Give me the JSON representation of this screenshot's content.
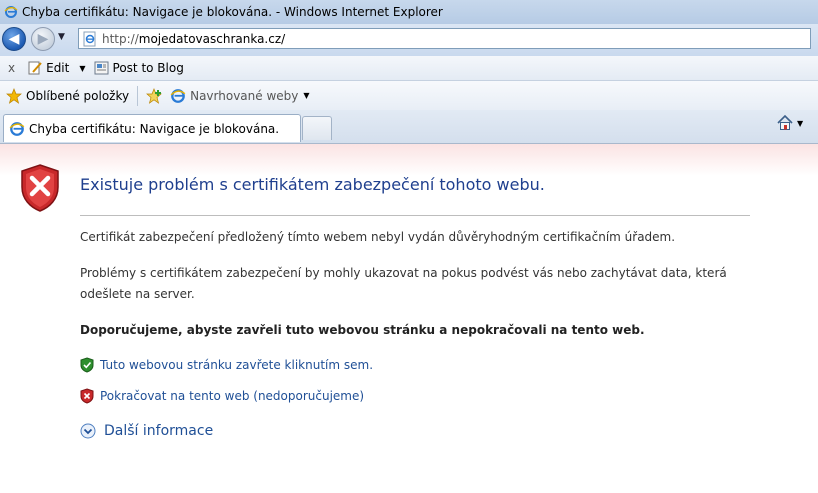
{
  "window": {
    "title": "Chyba certifikátu: Navigace je blokována. - Windows Internet Explorer"
  },
  "address": {
    "protocol": "http://",
    "host": "mojedatovaschranka.cz/"
  },
  "command_bar": {
    "close_label": "x",
    "edit_label": "Edit",
    "post_label": "Post to Blog"
  },
  "favorites_bar": {
    "favorites_label": "Oblíbené položky",
    "suggested_label": "Navrhované weby"
  },
  "tabs": [
    {
      "label": "Chyba certifikátu: Navigace je blokována."
    }
  ],
  "page": {
    "heading": "Existuje problém s certifikátem zabezpečení tohoto webu.",
    "paragraph1": "Certifikát zabezpečení předložený tímto webem nebyl vydán důvěryhodným certifikačním úřadem.",
    "paragraph2": "Problémy s certifikátem zabezpečení by mohly ukazovat na pokus podvést vás nebo zachytávat data, která odešlete na server.",
    "recommendation": "Doporučujeme, abyste zavřeli tuto webovou stránku a nepokračovali na tento web.",
    "close_link": "Tuto webovou stránku zavřete kliknutím sem.",
    "continue_link": "Pokračovat na tento web (nedoporučujeme)",
    "more_info": "Další informace"
  },
  "colors": {
    "heading": "#1f3f8e",
    "link": "#1f4f96",
    "shield_red": "#c8282a",
    "shield_green": "#2e8f2e"
  }
}
